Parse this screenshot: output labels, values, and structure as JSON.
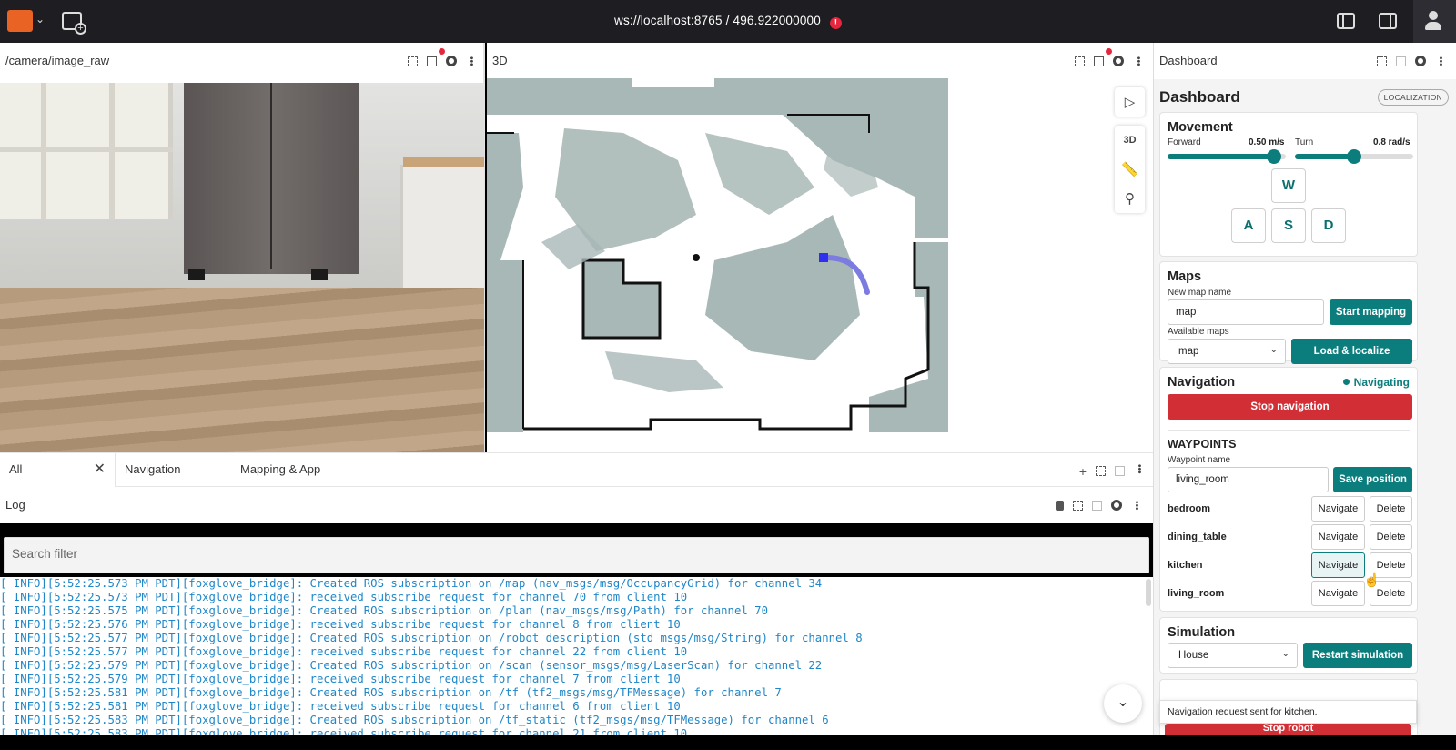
{
  "topbar": {
    "connection": "ws://localhost:8765 / 496.922000000",
    "warning_glyph": "!"
  },
  "camera_panel": {
    "title": "/camera/image_raw"
  },
  "view3d_panel": {
    "title": "3D",
    "tools": {
      "mode_label": "3D"
    }
  },
  "tabs": [
    {
      "label": "All",
      "active": true
    },
    {
      "label": "Navigation",
      "active": false
    },
    {
      "label": "Mapping & App",
      "active": false
    }
  ],
  "log_panel": {
    "title": "Log",
    "search_placeholder": "Search filter",
    "lines": [
      "[ INFO][5:52:25.573 PM PDT][foxglove_bridge]: Created ROS subscription on /map (nav_msgs/msg/OccupancyGrid) for channel 34",
      "[ INFO][5:52:25.573 PM PDT][foxglove_bridge]: received subscribe request for channel 70 from client 10",
      "[ INFO][5:52:25.575 PM PDT][foxglove_bridge]: Created ROS subscription on /plan (nav_msgs/msg/Path) for channel 70",
      "[ INFO][5:52:25.576 PM PDT][foxglove_bridge]: received subscribe request for channel 8 from client 10",
      "[ INFO][5:52:25.577 PM PDT][foxglove_bridge]: Created ROS subscription on /robot_description (std_msgs/msg/String) for channel 8",
      "[ INFO][5:52:25.577 PM PDT][foxglove_bridge]: received subscribe request for channel 22 from client 10",
      "[ INFO][5:52:25.579 PM PDT][foxglove_bridge]: Created ROS subscription on /scan (sensor_msgs/msg/LaserScan) for channel 22",
      "[ INFO][5:52:25.579 PM PDT][foxglove_bridge]: received subscribe request for channel 7 from client 10",
      "[ INFO][5:52:25.581 PM PDT][foxglove_bridge]: Created ROS subscription on /tf (tf2_msgs/msg/TFMessage) for channel 7",
      "[ INFO][5:52:25.581 PM PDT][foxglove_bridge]: received subscribe request for channel 6 from client 10",
      "[ INFO][5:52:25.583 PM PDT][foxglove_bridge]: Created ROS subscription on /tf_static (tf2_msgs/msg/TFMessage) for channel 6",
      "[ INFO][5:52:25.583 PM PDT][foxglove_bridge]: received subscribe request for channel 21 from client 10"
    ]
  },
  "dashboard": {
    "panel_title": "Dashboard",
    "heading": "Dashboard",
    "badge": "LOCALIZATION",
    "movement": {
      "title": "Movement",
      "forward_label": "Forward",
      "forward_value": "0.50 m/s",
      "forward_fraction": 0.9,
      "turn_label": "Turn",
      "turn_value": "0.8 rad/s",
      "turn_fraction": 0.5,
      "keys": {
        "w": "W",
        "a": "A",
        "s": "S",
        "d": "D"
      }
    },
    "maps": {
      "title": "Maps",
      "new_map_label": "New map name",
      "new_map_value": "map",
      "start_mapping": "Start mapping",
      "available_label": "Available maps",
      "selected_map": "map",
      "load_localize": "Load & localize"
    },
    "navigation": {
      "title": "Navigation",
      "status": "Navigating",
      "stop": "Stop navigation",
      "waypoints_title": "WAYPOINTS",
      "waypoint_name_label": "Waypoint name",
      "waypoint_name_value": "living_room",
      "save_position": "Save position",
      "navigate_label": "Navigate",
      "delete_label": "Delete",
      "waypoints": [
        "bedroom",
        "dining_table",
        "kitchen",
        "living_room"
      ]
    },
    "simulation": {
      "title": "Simulation",
      "selected": "House",
      "restart": "Restart simulation"
    },
    "toast": "Navigation request sent for kitchen.",
    "stop_robot": "Stop robot"
  },
  "colors": {
    "accent": "#0c7d7d",
    "danger": "#d12f35",
    "log_text": "#1f87c9",
    "map_occupied": "#a8b8b6",
    "path": "#7b7be0"
  }
}
